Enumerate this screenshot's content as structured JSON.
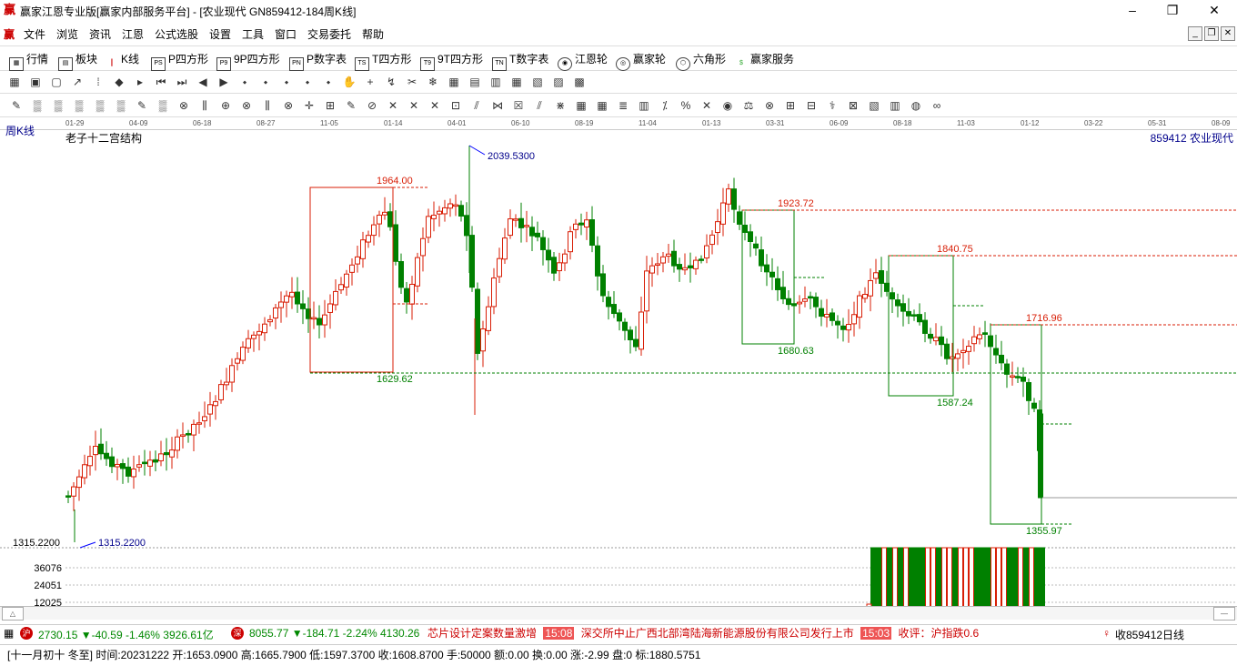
{
  "window": {
    "title": "赢家江恩专业版[赢家内部服务平台] - [农业现代  GN859412-184周K线]",
    "logo": "赢",
    "minimize": "–",
    "maximize": "❐",
    "close": "✕"
  },
  "menu": {
    "items": [
      "文件",
      "浏览",
      "资讯",
      "江恩",
      "公式选股",
      "设置",
      "工具",
      "窗口",
      "交易委托",
      "帮助"
    ]
  },
  "toolbar1": {
    "items": [
      {
        "icon": "table-icon",
        "label": "行情"
      },
      {
        "icon": "grid-icon",
        "label": "板块"
      },
      {
        "icon": "kline-icon",
        "label": "K线"
      },
      {
        "icon": "ps-icon",
        "label": "P四方形",
        "glyph": "PS"
      },
      {
        "icon": "p9-icon",
        "label": "9P四方形",
        "glyph": "P9"
      },
      {
        "icon": "pn-icon",
        "label": "P数字表",
        "glyph": "PN"
      },
      {
        "icon": "ts-icon",
        "label": "T四方形",
        "glyph": "TS"
      },
      {
        "icon": "t9-icon",
        "label": "9T四方形",
        "glyph": "T9"
      },
      {
        "icon": "tn-icon",
        "label": "T数字表",
        "glyph": "TN"
      },
      {
        "icon": "wheel-icon",
        "label": "江恩轮"
      },
      {
        "icon": "winwheel-icon",
        "label": "赢家轮"
      },
      {
        "icon": "hexagon-icon",
        "label": "六角形"
      },
      {
        "icon": "dollar-icon",
        "label": "赢家服务"
      }
    ]
  },
  "timeaxis": [
    "01-29",
    "04-09",
    "06-18",
    "08-27",
    "11-05",
    "01-14",
    "04-01",
    "06-10",
    "08-19",
    "11-04",
    "01-13",
    "03-31",
    "06-09",
    "08-18",
    "11-03",
    "01-12",
    "03-22",
    "05-31",
    "08-09"
  ],
  "chart_header": {
    "period": "周K线",
    "indicator": "老子十二宫结构",
    "stock": "859412 农业现代"
  },
  "chart_data": {
    "type": "candlestick",
    "annotations": {
      "high_label": "2039.5300",
      "low_label": "1315.2200",
      "low_axis": "1315.2200",
      "box_levels": [
        "1964.00",
        "1629.62",
        "1923.72",
        "1680.63",
        "1840.75",
        "1587.24",
        "1716.96",
        "1355.97"
      ]
    },
    "volume_axis": [
      "36076",
      "24051",
      "12025"
    ]
  },
  "status1": {
    "idx1": "2730.15 ▼-40.59 -1.46% 3926.61亿",
    "idx2": "8055.77 ▼-184.71 -2.24% 4130.26",
    "ticker": [
      {
        "text": "芯片设计定案数量激增"
      },
      {
        "time": "15:08",
        "text": "深交所中止广西北部湾陆海新能源股份有限公司发行上市"
      },
      {
        "time": "15:03",
        "text": "收评：沪指跌0.6"
      }
    ],
    "right": "收859412日线"
  },
  "status2": {
    "text": "[十一月初十 冬至] 时间:20231222 开:1653.0900 高:1665.7900 低:1597.3700 收:1608.8700 手:50000 额:0.00 换:0.00 涨:-2.99 盘:0 标:1880.5751"
  },
  "colors": {
    "up": "#d81e06",
    "down": "#008000",
    "high": "#00008b"
  }
}
